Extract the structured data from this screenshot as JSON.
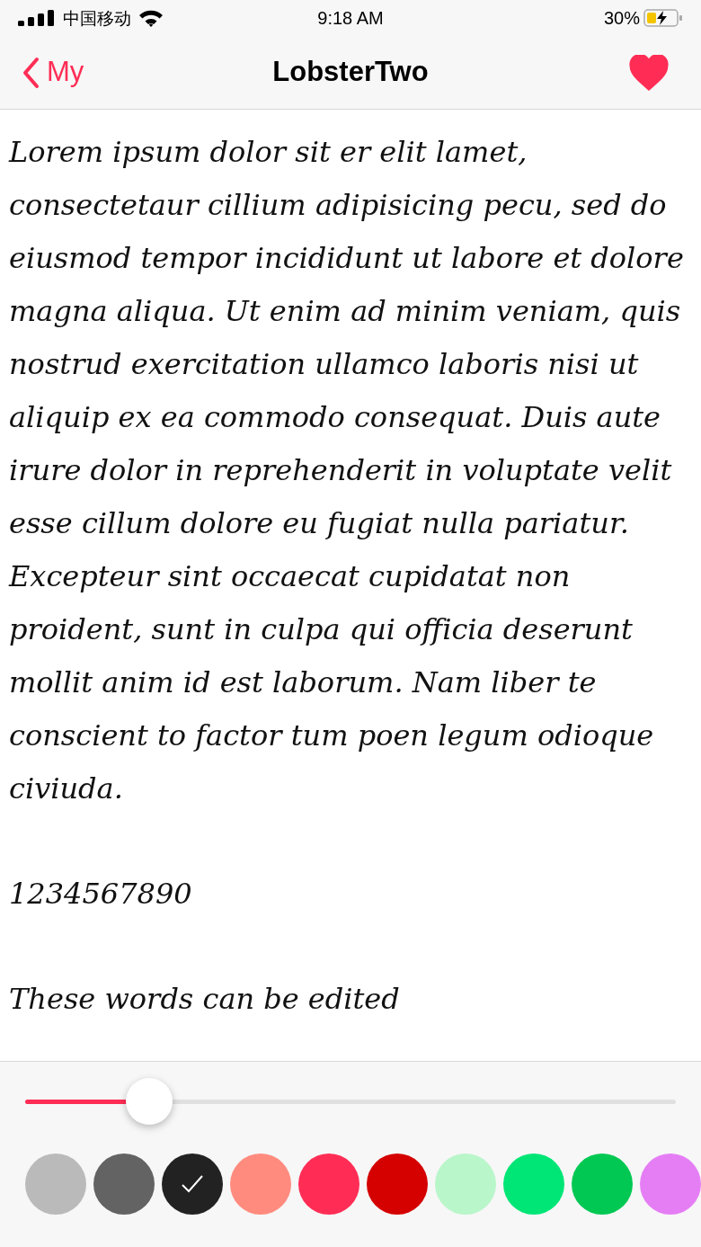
{
  "status_bar": {
    "carrier": "中国移动",
    "time": "9:18 AM",
    "battery": "30%"
  },
  "nav": {
    "back": "My",
    "title": "LobsterTwo",
    "favorited": true
  },
  "paragraphs": [
    "Lorem ipsum dolor sit er elit lamet, consectetaur cillium adipisicing pecu, sed do eiusmod tempor incididunt ut labore et dolore magna aliqua. Ut enim ad minim veniam, quis nostrud exercitation ullamco laboris nisi ut aliquip ex ea commodo consequat. Duis aute irure dolor in reprehenderit in voluptate velit esse cillum dolore eu fugiat nulla pariatur. Excepteur sint occaecat cupidatat non proident, sunt in culpa qui officia deserunt mollit anim id est laborum. Nam liber te conscient to factor tum poen legum odioque civiuda.",
    "1234567890",
    "These words can be edited"
  ],
  "size_slider": {
    "level": 0.19
  },
  "colors": [
    {
      "color": "#bababa",
      "selected": false
    },
    {
      "color": "#636363",
      "selected": false
    },
    {
      "color": "#222222",
      "selected": true
    },
    {
      "color": "#ff8b7e",
      "selected": false
    },
    {
      "color": "#ff2d55",
      "selected": false
    },
    {
      "color": "#d50000",
      "selected": false
    },
    {
      "color": "#b9f6ca",
      "selected": false
    },
    {
      "color": "#00e676",
      "selected": false
    },
    {
      "color": "#00c853",
      "selected": false
    },
    {
      "color": "#e57ef5",
      "selected": false
    }
  ]
}
